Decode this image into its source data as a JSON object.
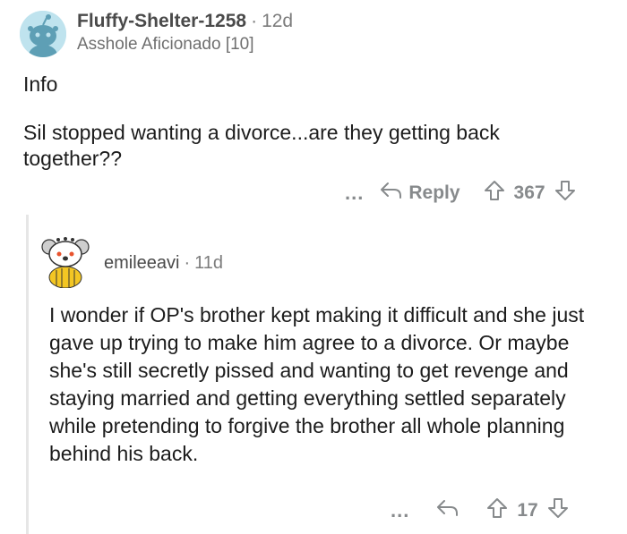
{
  "comment1": {
    "username": "Fluffy-Shelter-1258",
    "separator": "·",
    "time": "12d",
    "flair": "Asshole Aficionado [10]",
    "body_line1": "Info",
    "body_line2": "Sil stopped wanting a divorce...are they getting back together??",
    "more_label": "...",
    "reply_label": "Reply",
    "vote_count": "367"
  },
  "comment2": {
    "username": "emileeavi",
    "separator": "·",
    "time": "11d",
    "body": "I wonder if OP's brother kept making it difficult and she just gave up trying to make him agree to a divorce. Or maybe she's still secretly pissed and wanting to get revenge and staying married and getting everything settled separately while pretending to forgive the brother all whole planning behind his back.",
    "more_label": "...",
    "vote_count": "17"
  },
  "colors": {
    "text": "#1c1c1c",
    "meta": "#7c7c7c",
    "action": "#878a8c",
    "avatar_bg": "#bfe3ee",
    "thread_line": "#e6e6e6"
  }
}
